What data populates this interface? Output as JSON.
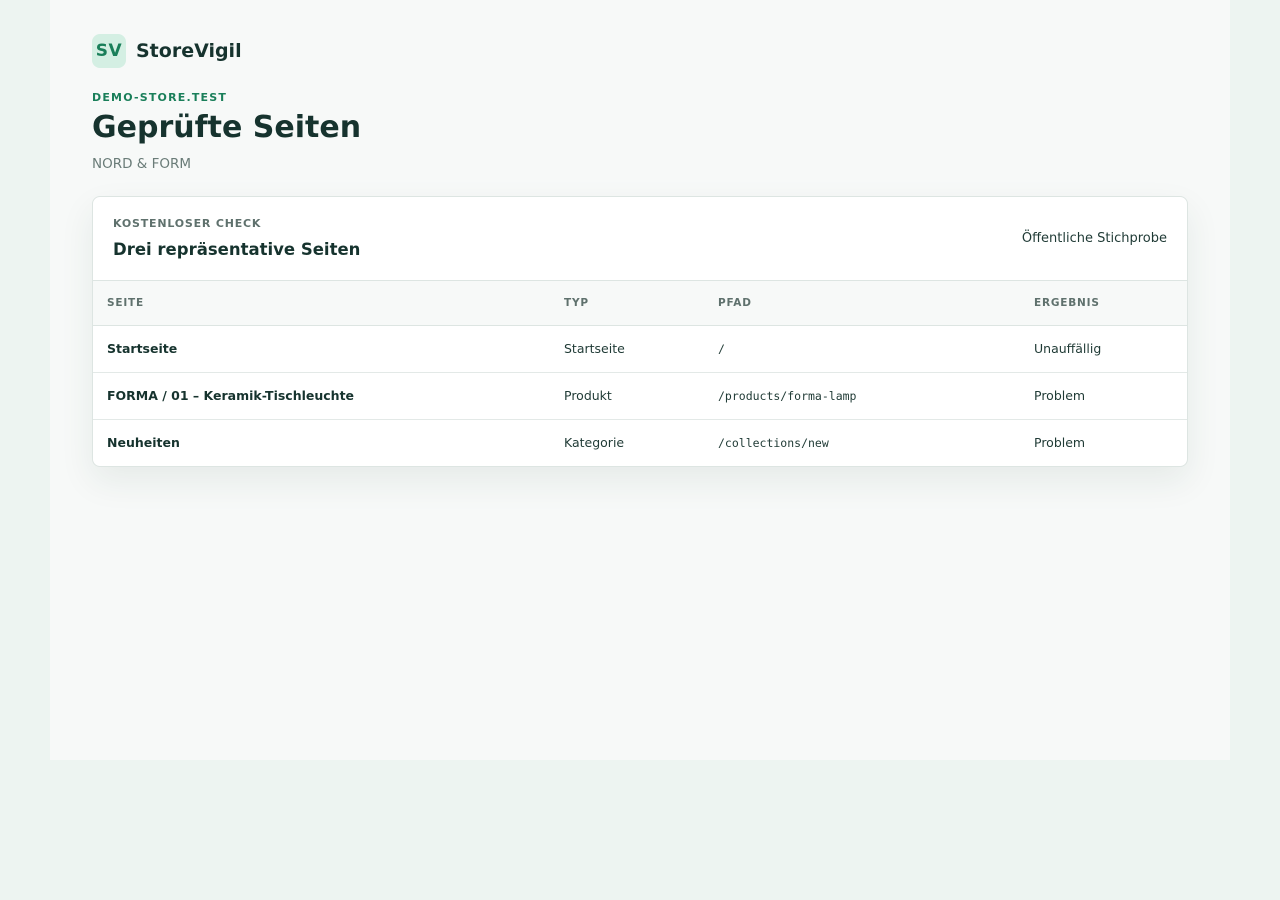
{
  "brand": {
    "logo_text": "SV",
    "name": "StoreVigil"
  },
  "header": {
    "eyebrow": "DEMO-STORE.TEST",
    "title": "Geprüfte Seiten",
    "subtitle": "NORD & FORM"
  },
  "card": {
    "eyebrow": "KOSTENLOSER CHECK",
    "title": "Drei repräsentative Seiten",
    "note": "Öffentliche Stichprobe",
    "columns": [
      "SEITE",
      "TYP",
      "PFAD",
      "ERGEBNIS"
    ],
    "rows": [
      {
        "page": "Startseite",
        "type": "Startseite",
        "path": "/",
        "result": "Unauffällig"
      },
      {
        "page": "FORMA / 01 – Keramik-Tischleuchte",
        "type": "Produkt",
        "path": "/products/forma-lamp",
        "result": "Problem"
      },
      {
        "page": "Neuheiten",
        "type": "Kategorie",
        "path": "/collections/new",
        "result": "Problem"
      }
    ]
  }
}
